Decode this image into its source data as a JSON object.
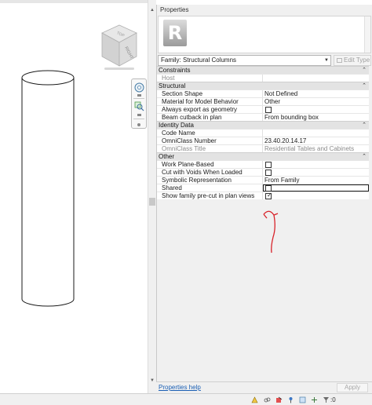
{
  "viewcube": {
    "face_label": "RIGHT",
    "top_label": "TOP"
  },
  "properties": {
    "title": "Properties",
    "logo_letter": "R",
    "family_selector": "Family: Structural Columns",
    "edit_type_label": "Edit Type",
    "categories": [
      {
        "name": "Constraints",
        "rows": [
          {
            "label": "Host",
            "value": "",
            "readonly": true
          }
        ]
      },
      {
        "name": "Structural",
        "rows": [
          {
            "label": "Section Shape",
            "value": "Not Defined"
          },
          {
            "label": "Material for Model Behavior",
            "value": "Other"
          },
          {
            "label": "Always export as geometry",
            "checkbox": true,
            "checked": false
          },
          {
            "label": "Beam cutback in plan",
            "value": "From bounding box"
          }
        ]
      },
      {
        "name": "Identity Data",
        "rows": [
          {
            "label": "Code Name",
            "value": ""
          },
          {
            "label": "OmniClass Number",
            "value": "23.40.20.14.17"
          },
          {
            "label": "OmniClass Title",
            "value": "Residential Tables and Cabinets",
            "readonly": true
          }
        ]
      },
      {
        "name": "Other",
        "rows": [
          {
            "label": "Work Plane-Based",
            "checkbox": true,
            "checked": false
          },
          {
            "label": "Cut with Voids When Loaded",
            "checkbox": true,
            "checked": false
          },
          {
            "label": "Symbolic Representation",
            "value": "From Family"
          },
          {
            "label": "Shared",
            "checkbox": true,
            "checked": false,
            "selected": true
          },
          {
            "label": "Show family pre-cut in plan views",
            "checkbox": true,
            "checked": true
          }
        ]
      }
    ],
    "help_link": "Properties help",
    "apply_label": "Apply"
  },
  "status_bar": {
    "selection_count": ":0"
  },
  "colors": {
    "annotation_arrow": "#d8232a",
    "link": "#1a5fb4",
    "category_bg": "#e3e3e3"
  }
}
